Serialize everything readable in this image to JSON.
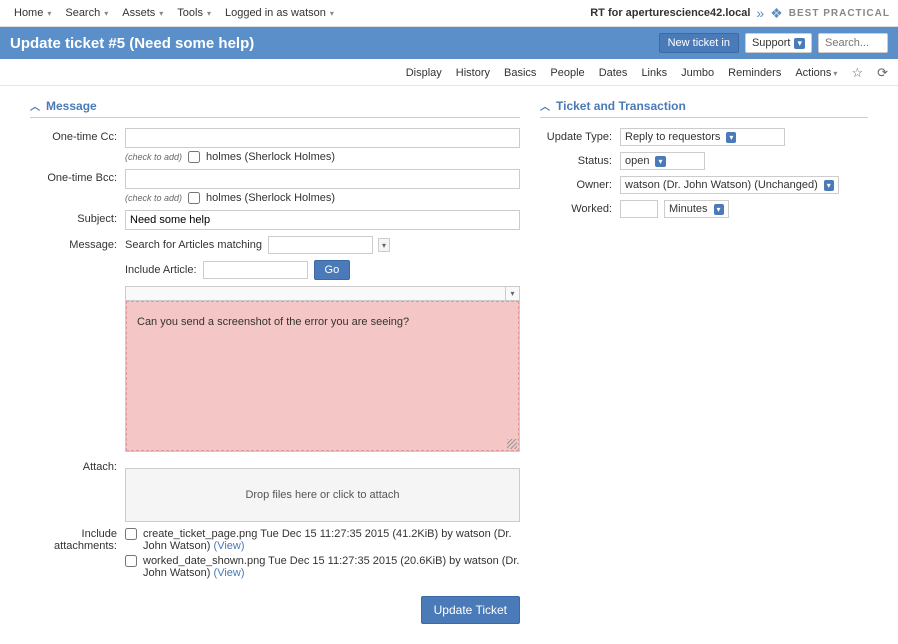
{
  "topnav": {
    "items": [
      "Home",
      "Search",
      "Assets",
      "Tools"
    ],
    "logged_in": "Logged in as watson",
    "site_name": "RT for aperturescience42.local",
    "brand": "BEST PRACTICAL"
  },
  "header": {
    "title": "Update ticket #5 (Need some help)",
    "new_ticket": "New ticket in",
    "support": "Support",
    "search_placeholder": "Search..."
  },
  "tabs": [
    "Display",
    "History",
    "Basics",
    "People",
    "Dates",
    "Links",
    "Jumbo",
    "Reminders",
    "Actions"
  ],
  "message": {
    "title": "Message",
    "cc_label": "One-time Cc:",
    "bcc_label": "One-time Bcc:",
    "check_hint": "(check to add)",
    "cc_option": "holmes (Sherlock Holmes)",
    "subject_label": "Subject:",
    "subject_value": "Need some help",
    "message_label": "Message:",
    "search_articles": "Search for Articles matching",
    "include_article": "Include Article:",
    "go": "Go",
    "body": "Can you send a screenshot of the error you are seeing?",
    "attach_label": "Attach:",
    "attach_hint": "Drop files here or click to attach",
    "include_label": "Include attachments:",
    "attachments": [
      {
        "name_ts_size_by": "create_ticket_page.png Tue Dec 15 11:27:35 2015 (41.2KiB) by watson (Dr. John Watson)",
        "view": "(View)"
      },
      {
        "name_ts_size_by": "worked_date_shown.png Tue Dec 15 11:27:35 2015 (20.6KiB) by watson (Dr. John Watson)",
        "view": "(View)"
      }
    ],
    "submit": "Update Ticket"
  },
  "txn": {
    "title": "Ticket and Transaction",
    "update_type_label": "Update Type:",
    "update_type": "Reply to requestors",
    "status_label": "Status:",
    "status": "open",
    "owner_label": "Owner:",
    "owner": "watson (Dr. John Watson) (Unchanged)",
    "worked_label": "Worked:",
    "worked_unit": "Minutes"
  }
}
